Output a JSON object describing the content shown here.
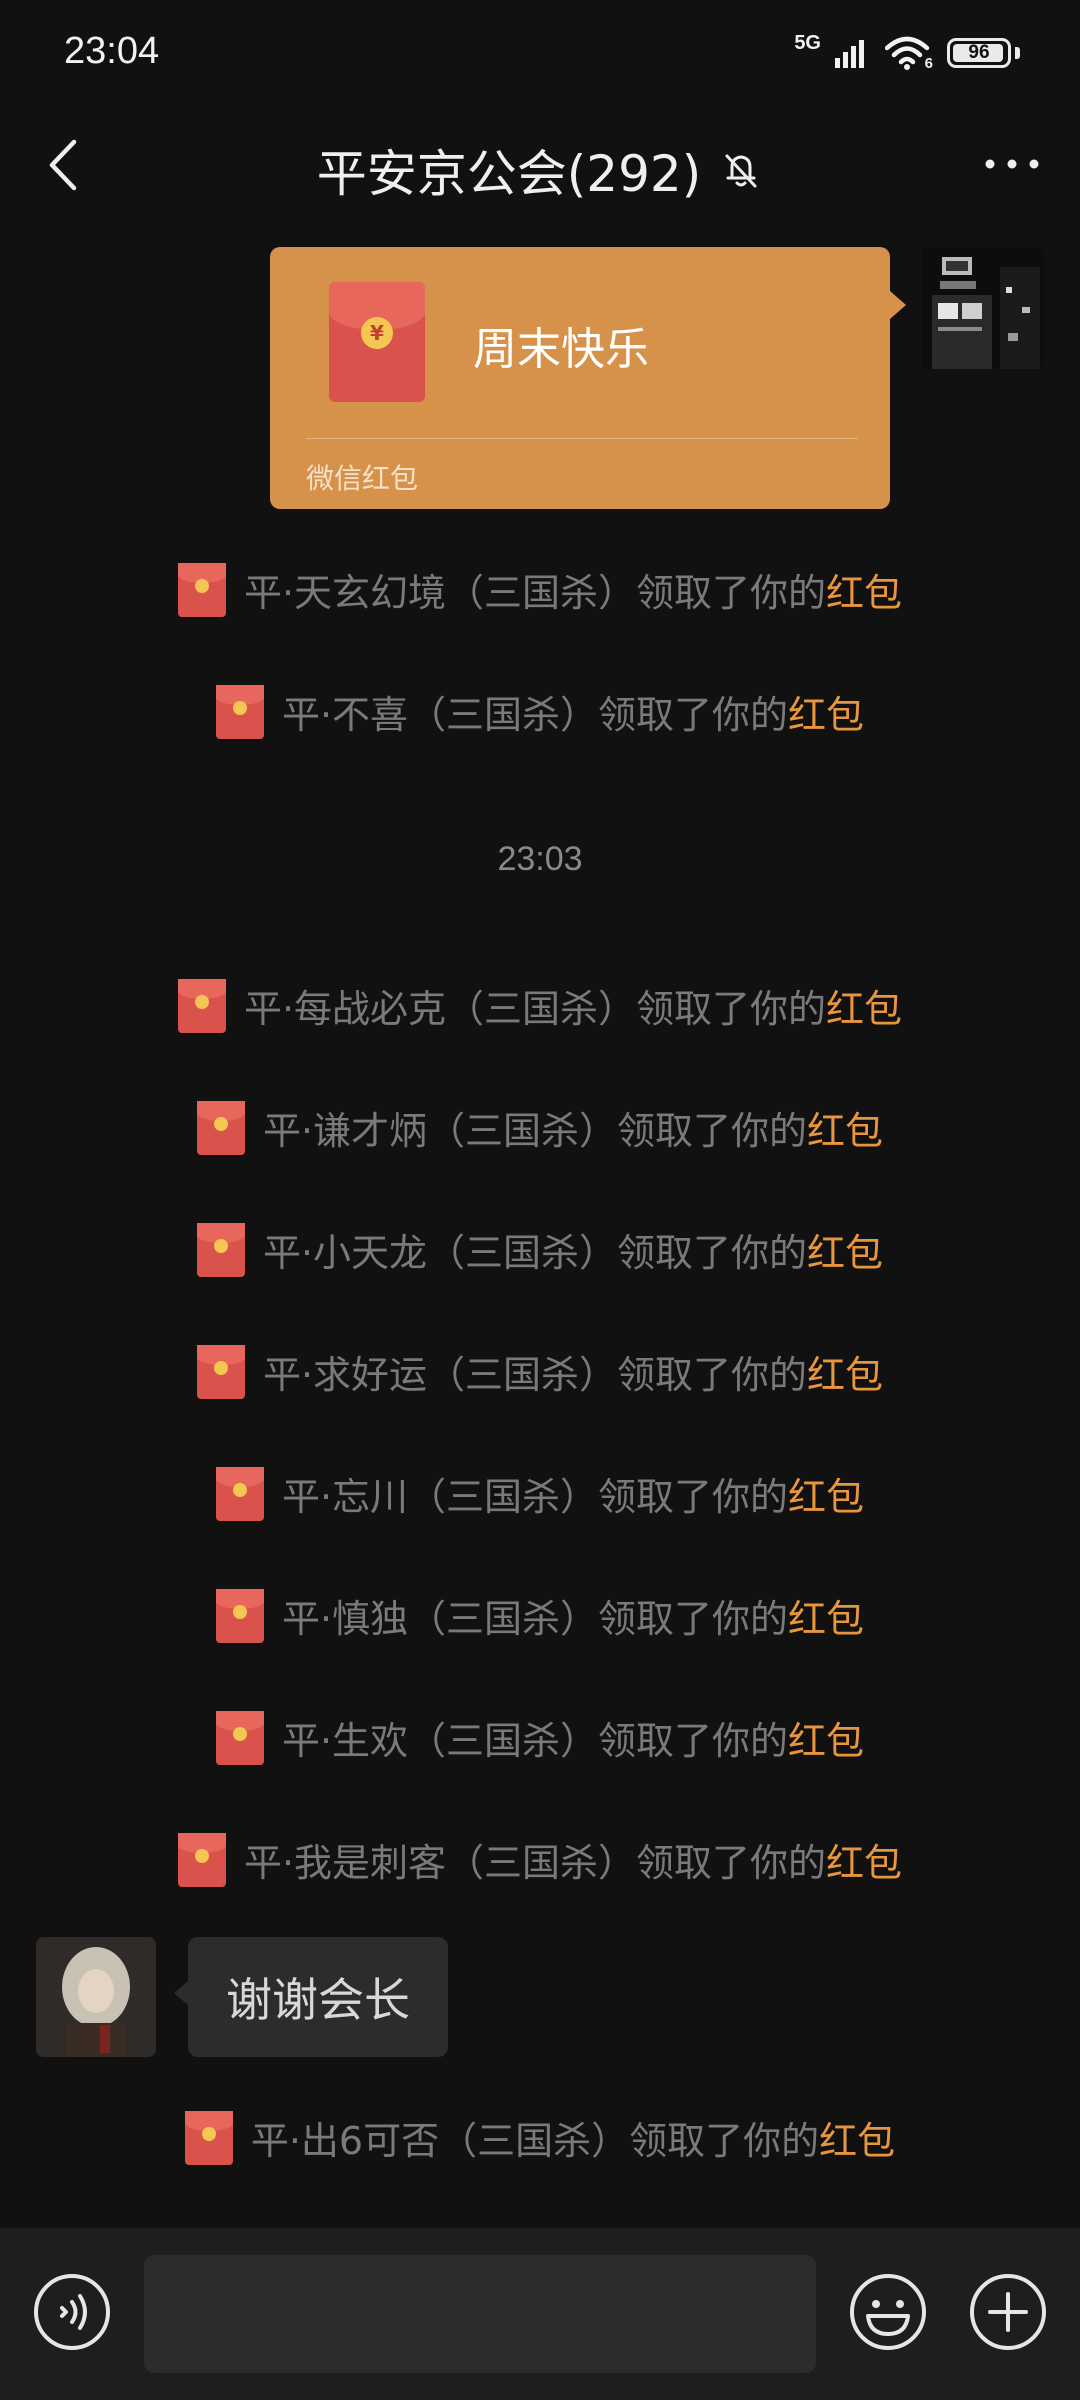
{
  "status_bar": {
    "time": "23:04",
    "network": "5G",
    "wifi_label": "6",
    "battery": "96",
    "battery_level": 0.96
  },
  "header": {
    "title": "平安京公会(292)",
    "muted": true
  },
  "red_packet": {
    "greeting": "周末快乐",
    "source": "微信红包",
    "coin_symbol": "¥"
  },
  "timestamp": "23:03",
  "notices_before": [
    {
      "name": "平·天玄幻境（三国杀）",
      "action": "领取了你的",
      "highlight": "红包"
    },
    {
      "name": "平·不喜（三国杀）",
      "action": "领取了你的",
      "highlight": "红包"
    }
  ],
  "notices_after": [
    {
      "name": "平·每战必克（三国杀）",
      "action": "领取了你的",
      "highlight": "红包"
    },
    {
      "name": "平·谦才炳（三国杀）",
      "action": "领取了你的",
      "highlight": "红包"
    },
    {
      "name": "平·小天龙（三国杀）",
      "action": "领取了你的",
      "highlight": "红包"
    },
    {
      "name": "平·求好运（三国杀）",
      "action": "领取了你的",
      "highlight": "红包"
    },
    {
      "name": "平·忘川（三国杀）",
      "action": "领取了你的",
      "highlight": "红包"
    },
    {
      "name": "平·慎独（三国杀）",
      "action": "领取了你的",
      "highlight": "红包"
    },
    {
      "name": "平·生欢（三国杀）",
      "action": "领取了你的",
      "highlight": "红包"
    },
    {
      "name": "平·我是刺客（三国杀）",
      "action": "领取了你的",
      "highlight": "红包"
    }
  ],
  "message": {
    "text": "谢谢会长"
  },
  "notice_last": {
    "name": "平·出6可否（三国杀）",
    "action": "领取了你的",
    "highlight": "红包"
  },
  "input": {
    "value": "",
    "placeholder": ""
  },
  "colors": {
    "background": "#111111",
    "packet_card": "#d6924a",
    "packet_red": "#d9534c",
    "highlight": "#e8963e",
    "bubble": "#2c2c2c"
  }
}
